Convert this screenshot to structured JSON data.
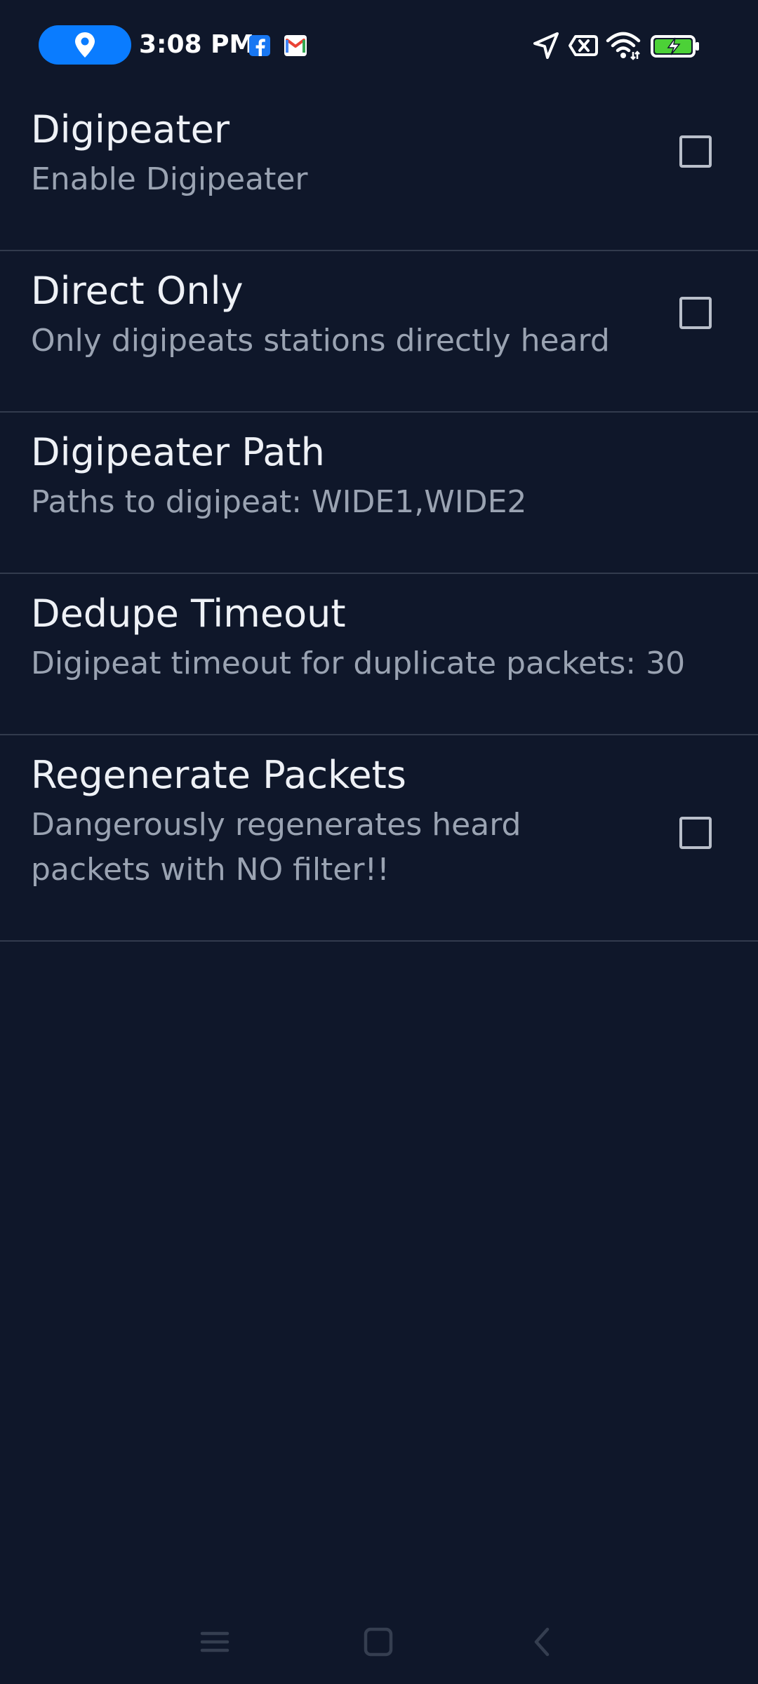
{
  "status_bar": {
    "time": "3:08 PM",
    "icons": [
      "location-pin-icon",
      "facebook-icon",
      "gmail-icon",
      "navigation-arrow-icon",
      "no-sim-icon",
      "wifi-icon",
      "battery-charging-icon"
    ]
  },
  "settings": {
    "items": [
      {
        "title": "Digipeater",
        "summary": "Enable Digipeater",
        "has_checkbox": true,
        "checked": false
      },
      {
        "title": "Direct Only",
        "summary": "Only digipeats stations directly heard",
        "has_checkbox": true,
        "checked": false
      },
      {
        "title": "Digipeater Path",
        "summary": "Paths to digipeat: WIDE1,WIDE2",
        "has_checkbox": false
      },
      {
        "title": "Dedupe Timeout",
        "summary": "Digipeat timeout for duplicate packets: 30",
        "has_checkbox": false
      },
      {
        "title": "Regenerate Packets",
        "summary": "Dangerously regenerates heard packets with NO filter!!",
        "has_checkbox": true,
        "checked": false
      }
    ]
  },
  "nav_bar": {
    "icons": [
      "menu-icon",
      "home-icon",
      "back-icon"
    ]
  },
  "colors": {
    "background": "#0f172a",
    "divider": "#323b4d",
    "title_text": "#eef1f6",
    "summary_text": "#9aa3b2",
    "location_pill": "#0a7cff",
    "battery_fill": "#4cd137"
  }
}
